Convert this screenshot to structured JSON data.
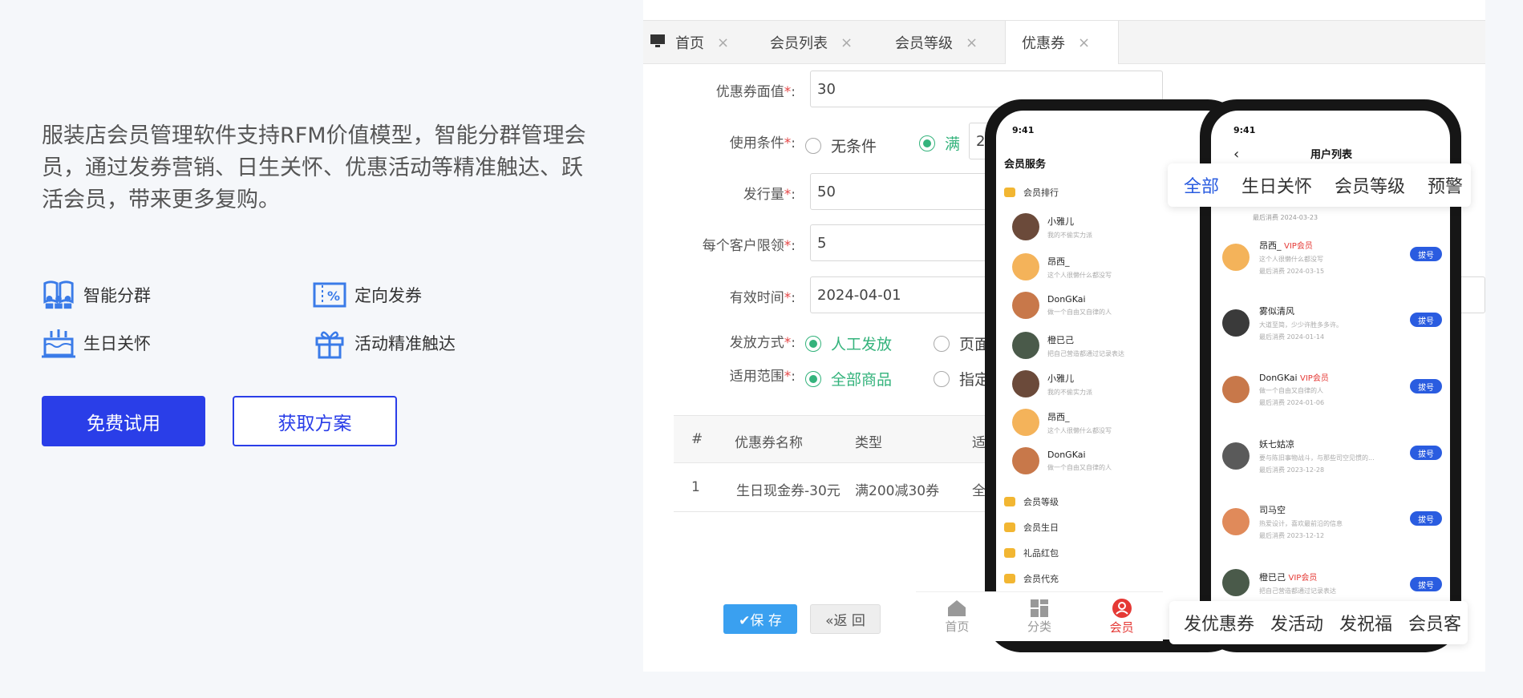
{
  "intro": {
    "text": "服装店会员管理软件支持RFM价值模型，智能分群管理会员，通过发券营销、日生关怀、优惠活动等精准触达、跃活会员，带来更多复购。"
  },
  "features": [
    {
      "icon": "group-icon",
      "label": "智能分群"
    },
    {
      "icon": "coupon-icon",
      "label": "定向发券"
    },
    {
      "icon": "cake-icon",
      "label": "生日关怀"
    },
    {
      "icon": "gift-icon",
      "label": "活动精准触达"
    }
  ],
  "buttons": {
    "trial": "免费试用",
    "plan": "获取方案"
  },
  "admin": {
    "tabs": [
      {
        "label": "首页",
        "icon": "monitor-icon"
      },
      {
        "label": "会员列表"
      },
      {
        "label": "会员等级"
      },
      {
        "label": "优惠券",
        "active": true
      }
    ],
    "close_glyph": "×",
    "form": {
      "face_value": {
        "label": "优惠券面值",
        "value": "30"
      },
      "condition": {
        "label": "使用条件",
        "opt1": "无条件",
        "opt2": "满",
        "partial": "20"
      },
      "issue_count": {
        "label": "发行量",
        "value": "50"
      },
      "limit": {
        "label": "每个客户限领",
        "value": "5"
      },
      "valid": {
        "label": "有效时间",
        "value": "2024-04-01"
      },
      "method": {
        "label": "发放方式",
        "opt1": "人工发放",
        "opt2": "页面"
      },
      "scope": {
        "label": "适用范围",
        "opt1": "全部商品",
        "opt2": "指定"
      },
      "required_mark": "*",
      "colon": ":"
    },
    "table": {
      "headers": [
        "#",
        "优惠券名称",
        "类型",
        "适用"
      ],
      "row": [
        "1",
        "生日现金券-30元",
        "满200减30券",
        "全部"
      ]
    },
    "save": "✔保 存",
    "back": "«返 回"
  },
  "phone1": {
    "time": "9:41",
    "title": "会员服务",
    "rank": "会员排行",
    "members": [
      {
        "name": "小雅儿",
        "desc": "我的不偷实力派"
      },
      {
        "name": "昂西_",
        "desc": "这个人很懒什么都没写"
      },
      {
        "name": "DonGKai",
        "desc": "做一个自由又自律的人"
      },
      {
        "name": "橙已己",
        "desc": "把自己营造都通过记录表达"
      },
      {
        "name": "小雅儿",
        "desc": "我的不偷实力派"
      },
      {
        "name": "昂西_",
        "desc": "这个人很懒什么都没写"
      },
      {
        "name": "DonGKai",
        "desc": "做一个自由又自律的人"
      }
    ],
    "menus": [
      "会员等级",
      "会员生日",
      "礼品红包",
      "会员代充"
    ]
  },
  "phone2": {
    "time": "9:41",
    "title": "用户列表",
    "filter_tabs": [
      "全部",
      "生日关怀",
      "会员等级",
      "预警"
    ],
    "first_date": "最后消费 2024-03-23",
    "users": [
      {
        "name": "昂西_",
        "vip": "VIP会员",
        "desc": "这个人很懒什么都没写",
        "date": "最后消费 2024-03-15"
      },
      {
        "name": "雾似清风",
        "vip": "",
        "desc": "大道至简，少少许胜多多许。",
        "date": "最后消费 2024-01-14"
      },
      {
        "name": "DonGKai",
        "vip": "VIP会员",
        "desc": "做一个自由又自律的人",
        "date": "最后消费 2024-01-06"
      },
      {
        "name": "妖七姑凉",
        "vip": "",
        "desc": "要与陈旧事物战斗，与那些司空见惯的...",
        "date": "最后消费 2023-12-28"
      },
      {
        "name": "司马空",
        "vip": "",
        "desc": "热爱设计，喜欢最前沿的信息",
        "date": "最后消费 2023-12-12"
      },
      {
        "name": "橙已己",
        "vip": "VIP会员",
        "desc": "把自己营造都通过记录表达",
        "date": ""
      }
    ],
    "call_label": "拔号",
    "actions": [
      "发优惠券",
      "发活动",
      "发祝福",
      "会员客"
    ]
  },
  "bottom_nav": [
    {
      "label": "首页",
      "icon": "home-icon"
    },
    {
      "label": "分类",
      "icon": "category-icon"
    },
    {
      "label": "会员",
      "icon": "member-icon",
      "active": true
    }
  ],
  "colors": {
    "accent": "#2a3ee8",
    "green": "#34b37c",
    "blue_button": "#3aa0f0",
    "red": "#e53935"
  }
}
